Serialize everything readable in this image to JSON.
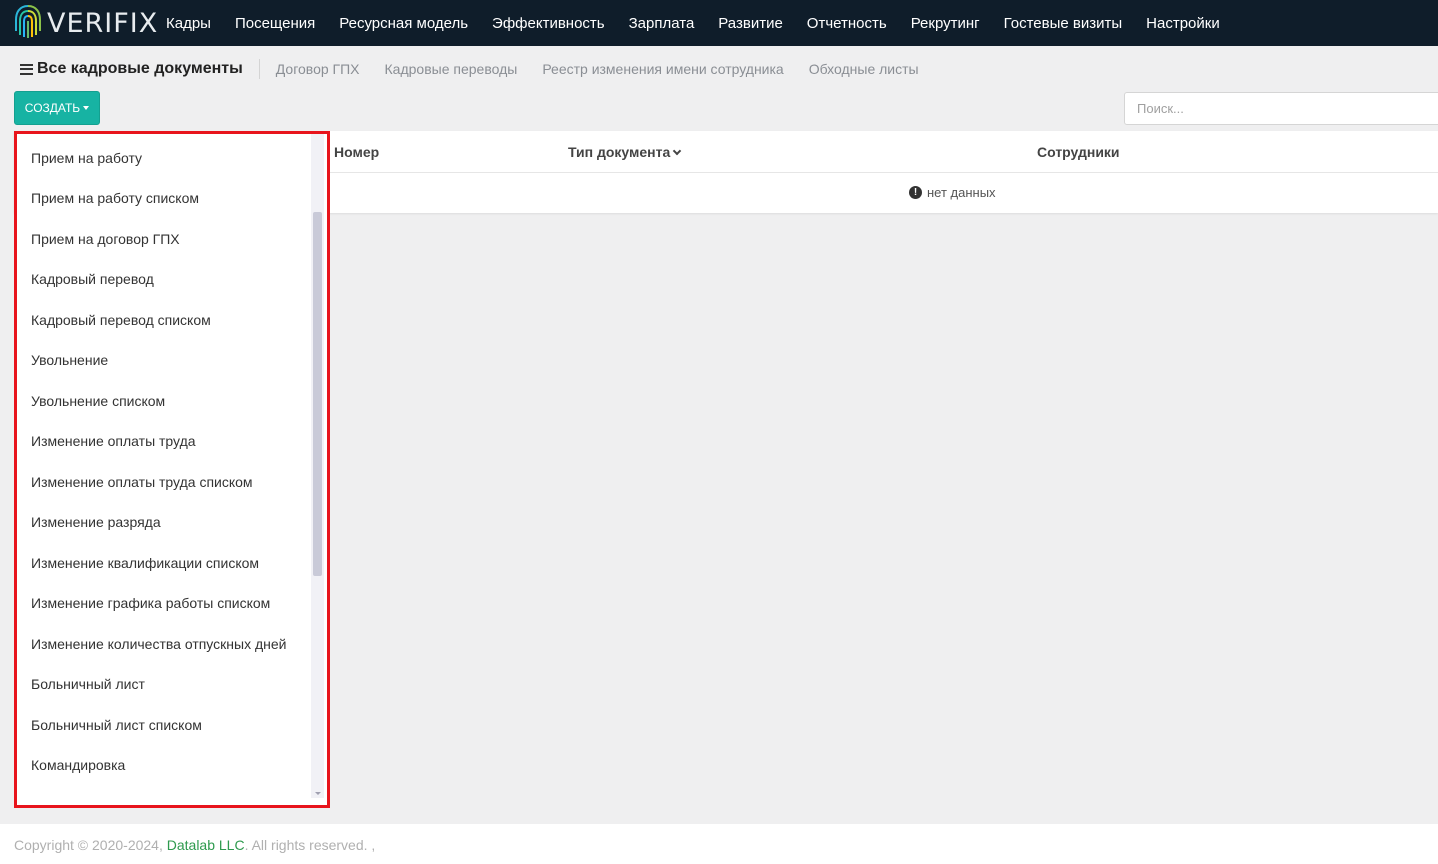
{
  "brand": {
    "logo_text": "VERIFIX"
  },
  "nav": [
    "Кадры",
    "Посещения",
    "Ресурсная модель",
    "Эффективность",
    "Зарплата",
    "Развитие",
    "Отчетность",
    "Рекрутинг",
    "Гостевые визиты",
    "Настройки"
  ],
  "subheader": {
    "title": "Все кадровые документы",
    "tabs": [
      "Договор ГПХ",
      "Кадровые переводы",
      "Реестр изменения имени сотрудника",
      "Обходные листы"
    ]
  },
  "toolbar": {
    "create_label": "СОЗДАТЬ"
  },
  "search": {
    "placeholder": "Поиск..."
  },
  "table": {
    "columns": [
      "Номер",
      "Тип документа",
      "Сотрудники"
    ],
    "empty_text": "нет данных"
  },
  "dropdown": {
    "items": [
      "Прием на работу",
      "Прием на работу списком",
      "Прием на договор ГПХ",
      "Кадровый перевод",
      "Кадровый перевод списком",
      "Увольнение",
      "Увольнение списком",
      "Изменение оплаты труда",
      "Изменение оплаты труда списком",
      "Изменение разряда",
      "Изменение квалификации списком",
      "Изменение графика работы списком",
      "Изменение количества отпускных дней",
      "Больничный лист",
      "Больничный лист списком",
      "Командировка"
    ]
  },
  "footer": {
    "prefix": "Copyright © 2020-2024, ",
    "company": "Datalab LLC",
    "suffix": ". All rights reserved. ,"
  },
  "colors": {
    "accent": "#17b3a3",
    "topbar": "#0f1d2a",
    "highlight": "#e8141c",
    "footer_link": "#2e9a4e"
  }
}
